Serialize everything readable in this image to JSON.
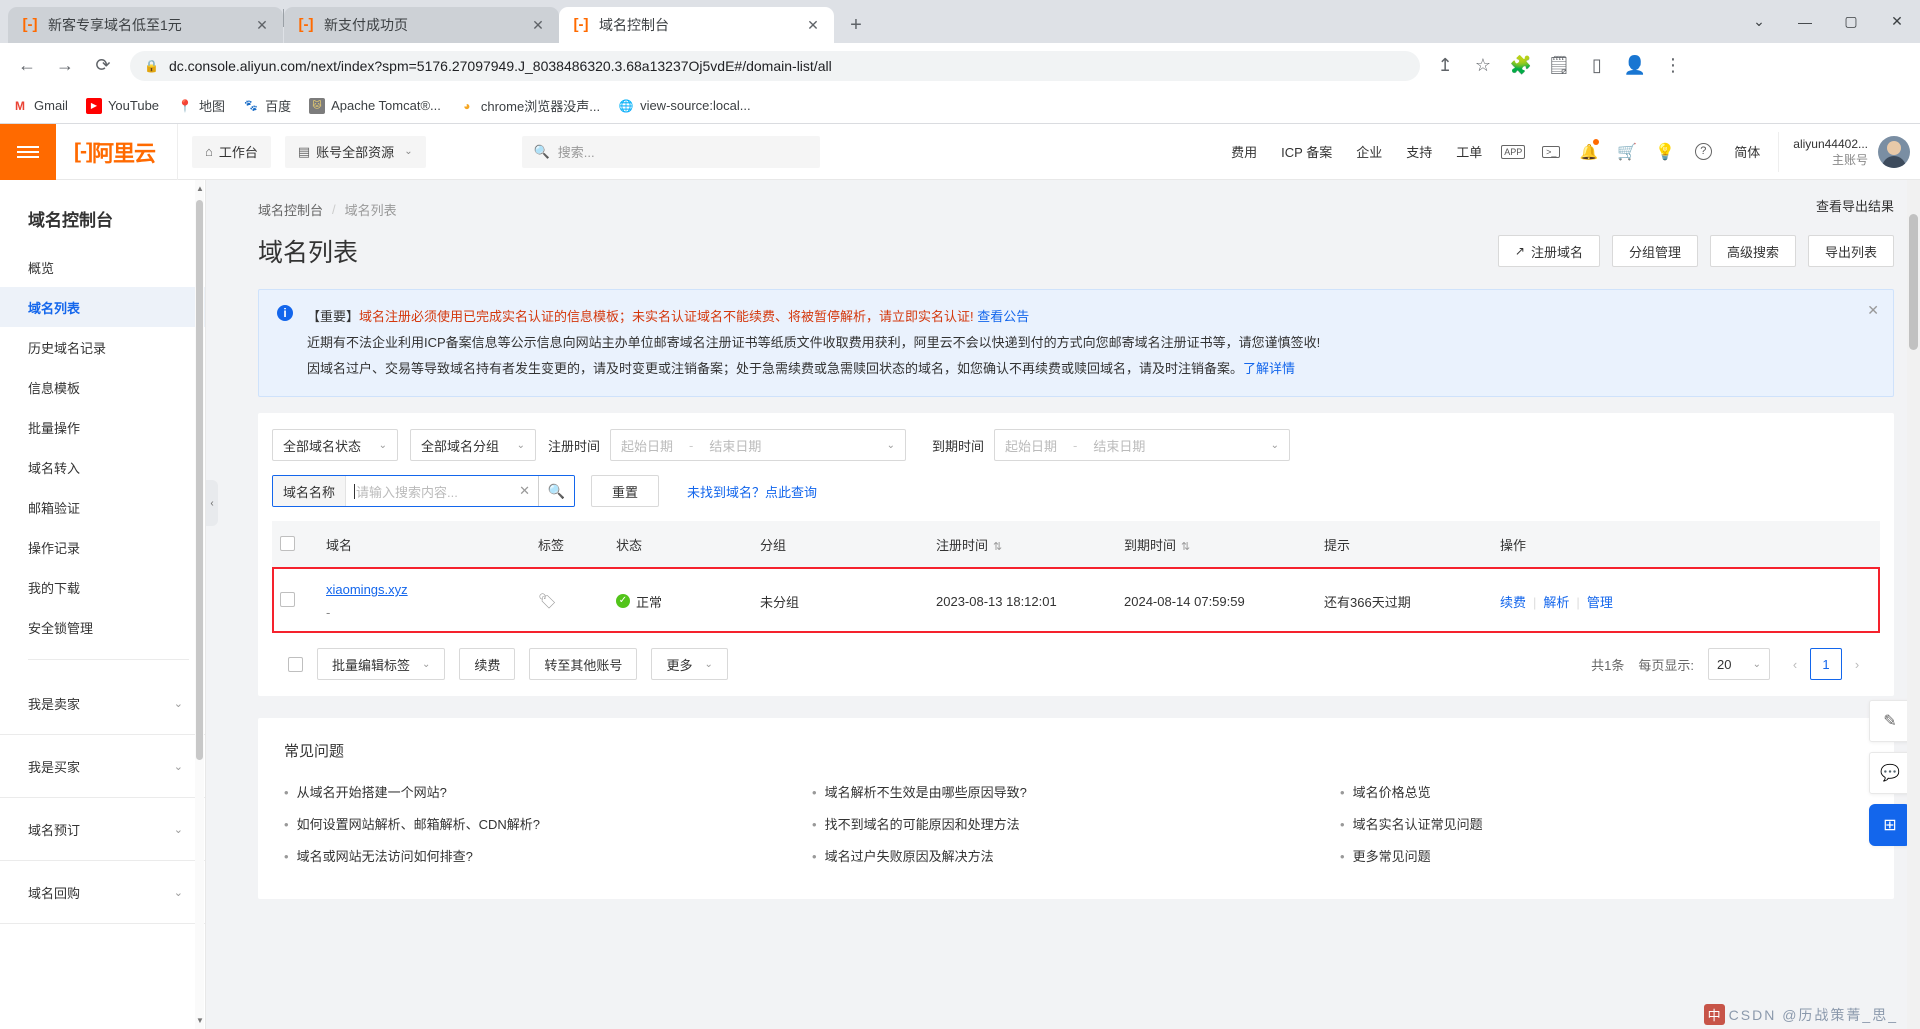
{
  "browser": {
    "tabs": [
      {
        "title": "新客专享域名低至1元",
        "active": false,
        "favicon": "aliyun-icon"
      },
      {
        "title": "新支付成功页",
        "active": false,
        "favicon": "aliyun-icon"
      },
      {
        "title": "域名控制台",
        "active": true,
        "favicon": "aliyun-icon"
      }
    ],
    "new_tab_label": "+",
    "window": {
      "minimize": "—",
      "maximize": "▢",
      "close": "✕",
      "chevron": "⌄"
    },
    "nav": {
      "back": "←",
      "forward": "→",
      "reload": "⟳"
    },
    "url": "dc.console.aliyun.com/next/index?spm=5176.27097949.J_8038486320.3.68a13237Oj5vdE#/domain-list/all",
    "lock": "🔒",
    "omni_icons": [
      "share-icon",
      "star-icon"
    ],
    "toolbar_icons": [
      "extensions-icon",
      "reading-list-icon",
      "sidepanel-icon",
      "profile-icon",
      "menu-icon"
    ],
    "bookmarks": [
      {
        "label": "Gmail",
        "icon": "M",
        "color": "#ea4335",
        "bg": "transparent"
      },
      {
        "label": "YouTube",
        "icon": "▶",
        "color": "#ffffff",
        "bg": "#ff0000"
      },
      {
        "label": "地图",
        "icon": "📍",
        "color": "#ea4335",
        "bg": "transparent"
      },
      {
        "label": "百度",
        "icon": "熊",
        "color": "#2932e1",
        "bg": "transparent"
      },
      {
        "label": "Apache Tomcat®...",
        "icon": "🐱",
        "color": "#f8dc75",
        "bg": "#6d6d6d"
      },
      {
        "label": "chrome浏览器没声...",
        "icon": "◕",
        "color": "#f5a623",
        "bg": "transparent"
      },
      {
        "label": "view-source:local...",
        "icon": "🌐",
        "color": "#5f6368",
        "bg": "transparent"
      }
    ]
  },
  "header": {
    "menu_icon": "hamburger-icon",
    "logo_text": "阿里云",
    "workbench": "工作台",
    "workbench_icon": "home-icon",
    "resources": "账号全部资源",
    "resources_icon": "grid-icon",
    "search_placeholder": "搜索...",
    "search_icon": "search-icon",
    "links": [
      "费用",
      "ICP 备案",
      "企业",
      "支持",
      "工单"
    ],
    "icons": [
      {
        "name": "app-icon",
        "glyph": "APP"
      },
      {
        "name": "terminal-icon",
        "glyph": "▣"
      },
      {
        "name": "bell-icon",
        "glyph": "🔔",
        "badge": true
      },
      {
        "name": "cart-icon",
        "glyph": "🛒"
      },
      {
        "name": "bulb-icon",
        "glyph": "💡"
      },
      {
        "name": "help-icon",
        "glyph": "?"
      }
    ],
    "language": "简体",
    "user_name": "aliyun44402...",
    "user_role": "主账号"
  },
  "sidebar": {
    "title": "域名控制台",
    "items": [
      {
        "label": "概览",
        "active": false
      },
      {
        "label": "域名列表",
        "active": true
      },
      {
        "label": "历史域名记录",
        "active": false
      },
      {
        "label": "信息模板",
        "active": false
      },
      {
        "label": "批量操作",
        "active": false
      },
      {
        "label": "域名转入",
        "active": false
      },
      {
        "label": "邮箱验证",
        "active": false
      },
      {
        "label": "操作记录",
        "active": false
      },
      {
        "label": "我的下载",
        "active": false
      },
      {
        "label": "安全锁管理",
        "active": false
      }
    ],
    "groups": [
      {
        "label": "我是卖家",
        "caret": "⌄"
      },
      {
        "label": "我是买家",
        "caret": "⌄"
      },
      {
        "label": "域名预订",
        "caret": "⌄"
      },
      {
        "label": "域名回购",
        "caret": "⌄"
      }
    ],
    "collapse_handle": "‹"
  },
  "main": {
    "breadcrumb": {
      "root": "域名控制台",
      "separator": "/",
      "current": "域名列表"
    },
    "title": "域名列表",
    "export_result_link": "查看导出结果",
    "actions": [
      {
        "label": "注册域名",
        "icon": "external-link-icon"
      },
      {
        "label": "分组管理",
        "icon": ""
      },
      {
        "label": "高级搜索",
        "icon": ""
      },
      {
        "label": "导出列表",
        "icon": ""
      }
    ],
    "alert": {
      "icon": "info-icon",
      "close": "✕",
      "line1_lead": "【重要】",
      "line1_main": "域名注册必须使用已完成实名认证的信息模板；未实名认证域名不能续费、将被暂停解析，请立即实名认证!",
      "line1_link": "查看公告",
      "line2": "近期有不法企业利用ICP备案信息等公示信息向网站主办单位邮寄域名注册证书等纸质文件收取费用获利，阿里云不会以快递到付的方式向您邮寄域名注册证书等，请您谨慎签收!",
      "line3": "因域名过户、交易等导致域名持有者发生变更的，请及时变更或注销备案；处于急需续费或急需赎回状态的域名，如您确认不再续费或赎回域名，请及时注销备案。",
      "line3_link": "了解详情"
    },
    "filters": {
      "status_select": "全部域名状态",
      "group_select": "全部域名分组",
      "reg_time_label": "注册时间",
      "exp_time_label": "到期时间",
      "date_start_placeholder": "起始日期",
      "date_end_placeholder": "结束日期",
      "date_dash": "-",
      "caret": "⌄",
      "search_prefix": "域名名称",
      "search_placeholder": "请输入搜索内容...",
      "search_clear": "✕",
      "search_icon": "search-icon",
      "reset_label": "重置",
      "not_found_link": "未找到域名？点此查询"
    },
    "table": {
      "columns": [
        {
          "label": "",
          "key": "checkbox"
        },
        {
          "label": "域名",
          "key": "domain"
        },
        {
          "label": "标签",
          "key": "tag"
        },
        {
          "label": "状态",
          "key": "status"
        },
        {
          "label": "分组",
          "key": "group"
        },
        {
          "label": "注册时间",
          "key": "reg_time",
          "sortable": true
        },
        {
          "label": "到期时间",
          "key": "exp_time",
          "sortable": true
        },
        {
          "label": "提示",
          "key": "tip"
        },
        {
          "label": "操作",
          "key": "ops"
        }
      ],
      "sort_glyph": "⇅",
      "rows": [
        {
          "domain": "xiaomings.xyz",
          "domain_sub": "-",
          "tag_icon": "tag-icon",
          "status": "正常",
          "status_glyph": "✓",
          "group": "未分组",
          "reg_time": "2023-08-13 18:12:01",
          "exp_time": "2024-08-14 07:59:59",
          "tip": "还有366天过期",
          "ops": [
            "续费",
            "解析",
            "管理"
          ],
          "highlighted": true
        }
      ]
    },
    "footer": {
      "batch_tag": "批量编辑标签",
      "renew": "续费",
      "transfer": "转至其他账号",
      "more": "更多",
      "caret": "⌄",
      "total": "共1条",
      "per_page_label": "每页显示:",
      "per_page_value": "20",
      "prev": "‹",
      "next": "›",
      "current_page": "1"
    },
    "faq": {
      "title": "常见问题",
      "bullet": "•",
      "columns": [
        [
          "从域名开始搭建一个网站?",
          "如何设置网站解析、邮箱解析、CDN解析?",
          "域名或网站无法访问如何排查?"
        ],
        [
          "域名解析不生效是由哪些原因导致?",
          "找不到域名的可能原因和处理方法",
          "域名过户失败原因及解决方法"
        ],
        [
          "域名价格总览",
          "域名实名认证常见问题",
          "更多常见问题"
        ]
      ]
    },
    "right_rail": [
      {
        "name": "edit-icon",
        "glyph": "✎",
        "style": "plain"
      },
      {
        "name": "feedback-icon",
        "glyph": "💬",
        "style": "plain"
      },
      {
        "name": "apps-icon",
        "glyph": "⊞",
        "style": "blue"
      }
    ],
    "watermark": {
      "badge": "中",
      "text": "CSDN @历战策菁_思_"
    }
  }
}
